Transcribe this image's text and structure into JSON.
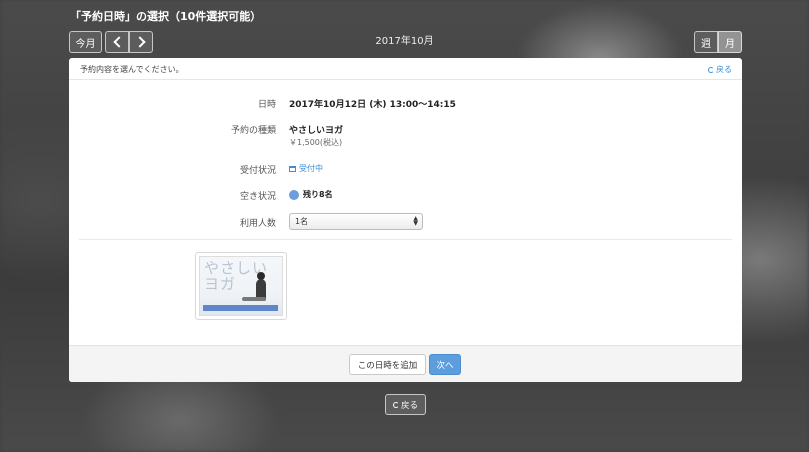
{
  "page": {
    "title": "「予約日時」の選択（10件選択可能）"
  },
  "toolbar": {
    "today_label": "今月",
    "month_label": "2017年10月",
    "week_label": "週",
    "month_view_label": "月"
  },
  "panel": {
    "instruction": "予約内容を選んでください。",
    "back_label": "戻る",
    "fields": {
      "datetime_label": "日時",
      "datetime_value": "2017年10月12日 (木) 13:00〜14:15",
      "type_label": "予約の種類",
      "type_value": "やさしいヨガ",
      "price_value": "￥1,500(税込)",
      "status_label": "受付状況",
      "status_value": "受付中",
      "availability_label": "空き状況",
      "availability_value": "残り8名",
      "people_label": "利用人数",
      "people_value": "1名"
    },
    "image": {
      "text_line1": "やさしい",
      "text_line2": "ヨガ"
    },
    "footer": {
      "add_datetime_label": "この日時を追加",
      "next_label": "次へ"
    }
  },
  "bottom": {
    "back_label": "戻る"
  },
  "colors": {
    "accent": "#3a8fd6",
    "primary_button": "#5b9ddd",
    "availability_dot": "#6a9fdc"
  }
}
